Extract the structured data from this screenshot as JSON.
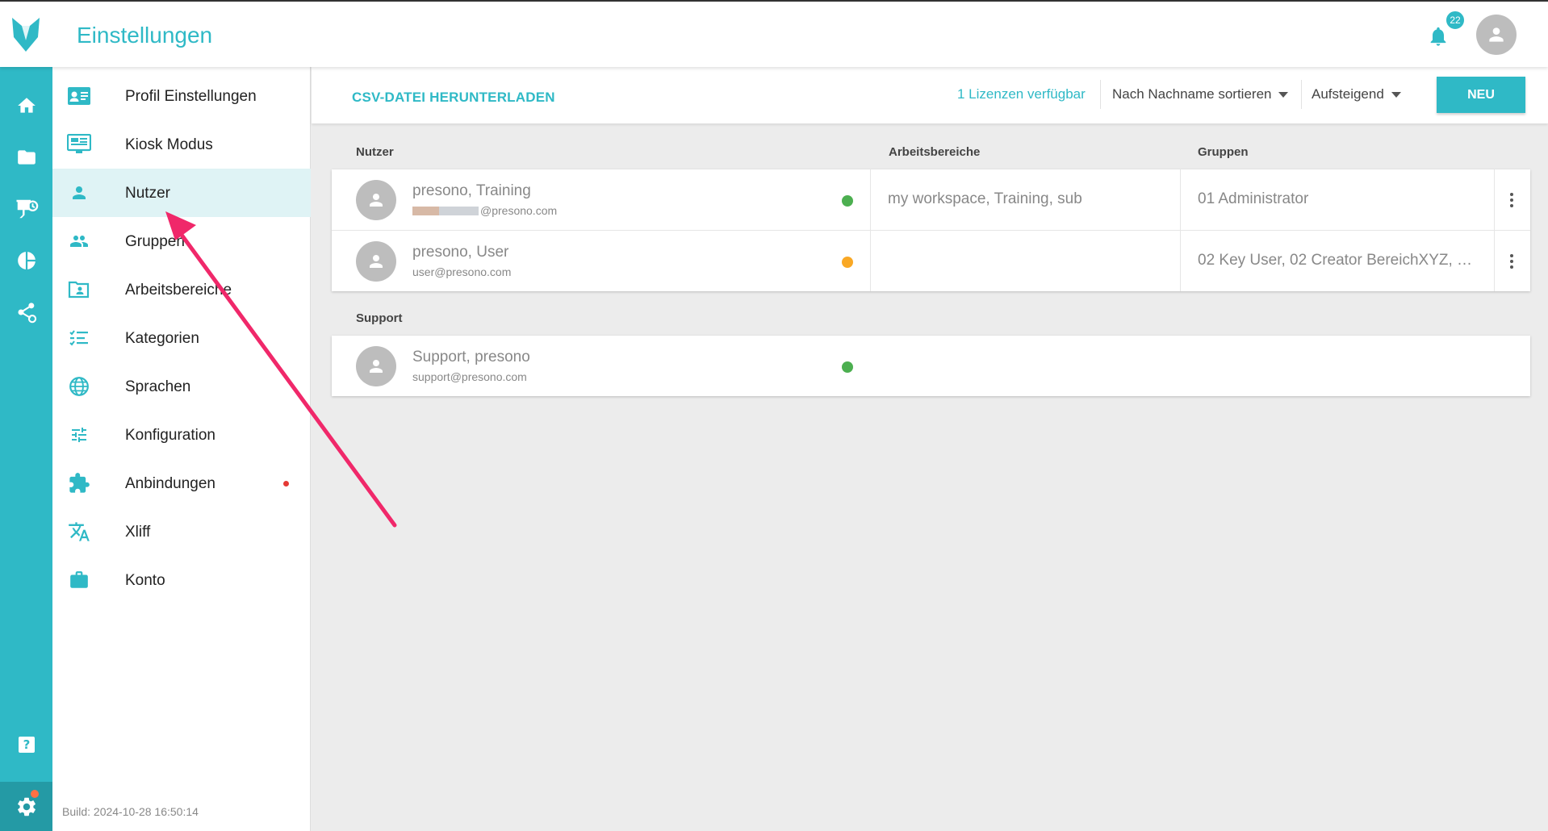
{
  "header": {
    "title": "Einstellungen",
    "notification_count": "22"
  },
  "rail": {
    "items": [
      "home-icon",
      "folder-icon",
      "presentation-icon",
      "pie-chart-icon",
      "share-icon"
    ],
    "help": "help-icon",
    "settings": "gear-icon"
  },
  "sidebar": {
    "items": [
      {
        "label": "Profil Einstellungen",
        "icon": "contact-card-icon"
      },
      {
        "label": "Kiosk Modus",
        "icon": "monitor-icon"
      },
      {
        "label": "Nutzer",
        "icon": "person-icon",
        "active": true
      },
      {
        "label": "Gruppen",
        "icon": "people-icon"
      },
      {
        "label": "Arbeitsbereiche",
        "icon": "folder-user-icon"
      },
      {
        "label": "Kategorien",
        "icon": "checklist-icon"
      },
      {
        "label": "Sprachen",
        "icon": "globe-icon"
      },
      {
        "label": "Konfiguration",
        "icon": "sliders-icon"
      },
      {
        "label": "Anbindungen",
        "icon": "puzzle-icon"
      },
      {
        "label": "Xliff",
        "icon": "translate-icon"
      },
      {
        "label": "Konto",
        "icon": "briefcase-icon"
      }
    ],
    "build": "Build: 2024-10-28 16:50:14"
  },
  "toolbar": {
    "csv_label": "CSV-DATEI HERUNTERLADEN",
    "licenses": "1 Lizenzen verfügbar",
    "sort_value": "Nach Nachname sortieren",
    "order_value": "Aufsteigend",
    "new_label": "NEU"
  },
  "table": {
    "headers": {
      "users": "Nutzer",
      "workspaces": "Arbeitsbereiche",
      "groups": "Gruppen"
    },
    "rows": [
      {
        "name": "presono, Training",
        "email": "@presono.com",
        "status": "#4caf50",
        "workspaces": "my workspace, Training, sub",
        "groups": "01 Administrator"
      },
      {
        "name": "presono, User",
        "email": "user@presono.com",
        "status": "#f9a825",
        "workspaces": "",
        "groups": "02 Key User, 02 Creator BereichXYZ, …"
      }
    ]
  },
  "support": {
    "heading": "Support",
    "row": {
      "name": "Support, presono",
      "email": "support@presono.com",
      "status": "#4caf50"
    }
  },
  "colors": {
    "accent": "#2fb9c6",
    "arrow": "#f0286a"
  }
}
